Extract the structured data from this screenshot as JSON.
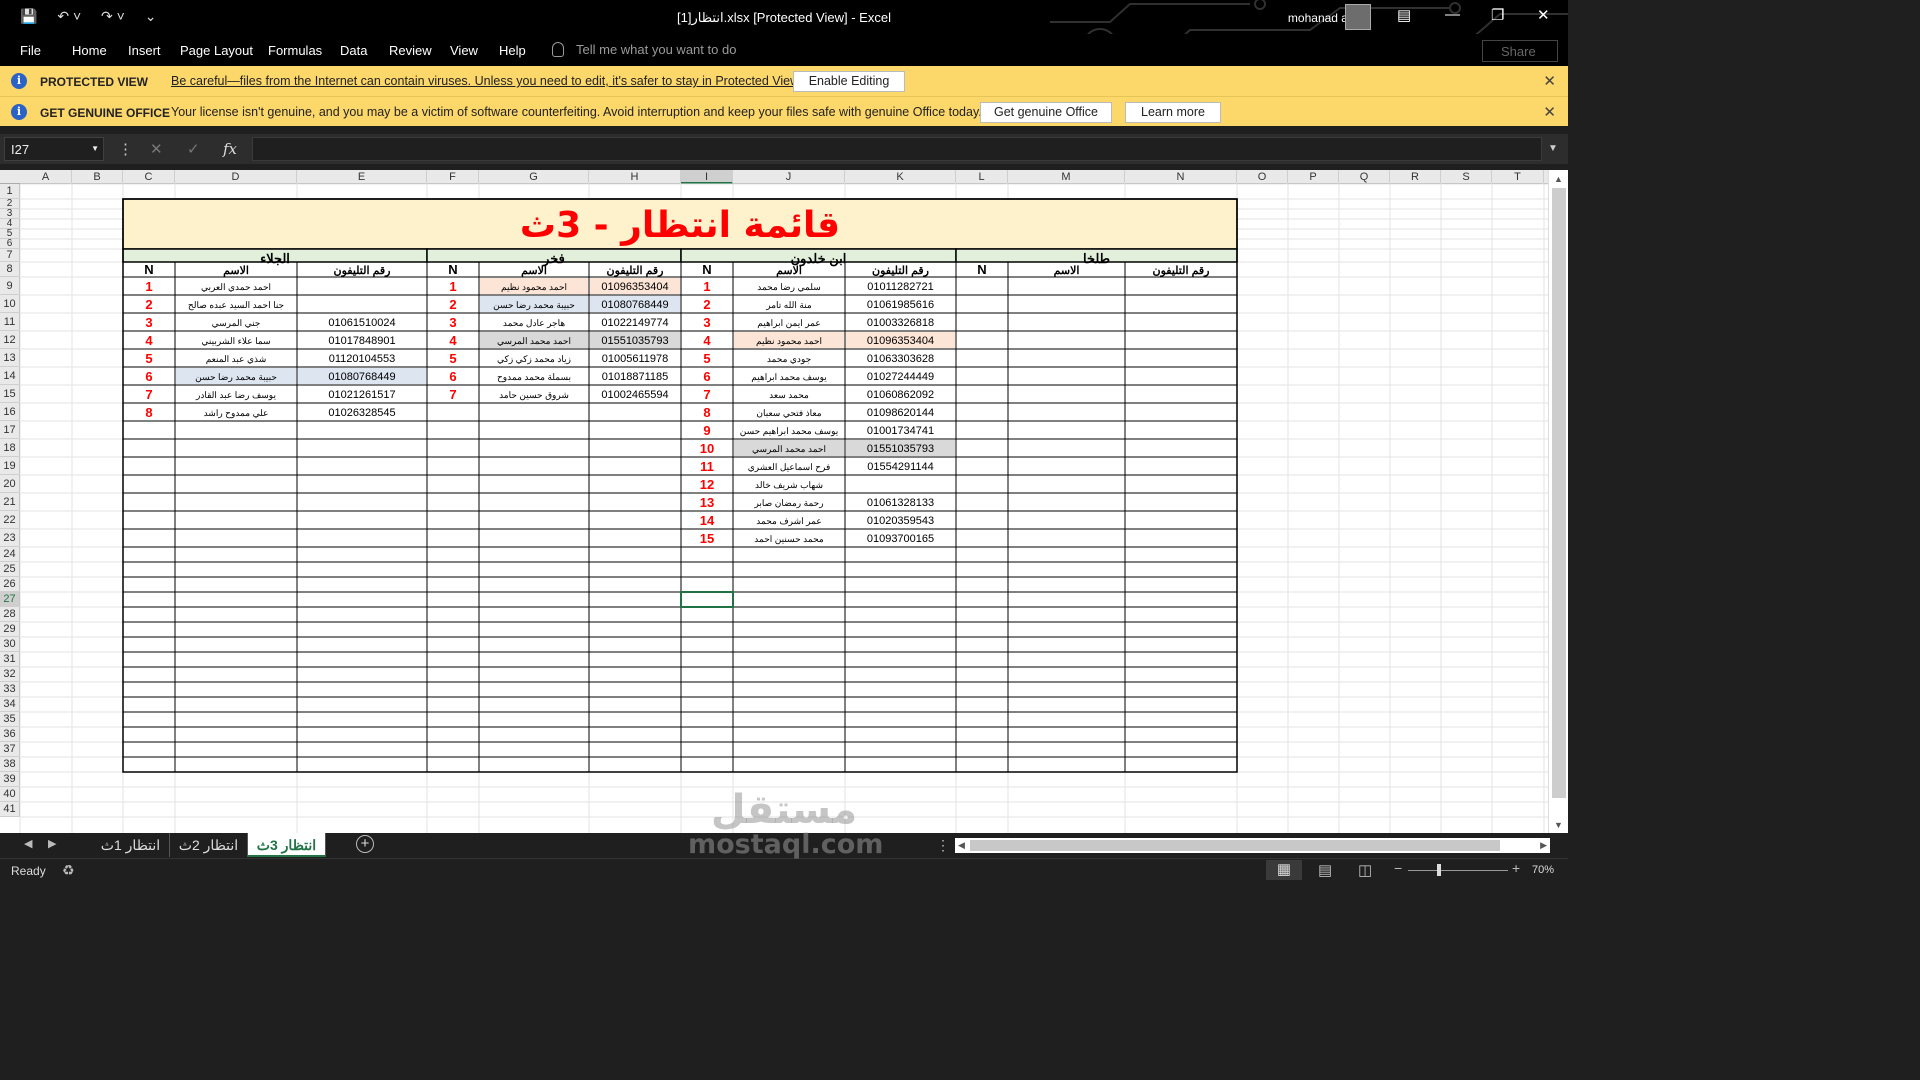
{
  "window": {
    "title": "انتظار[1].xlsx  [Protected View]  -  Excel",
    "user": "mohanad abdo",
    "share_label": "Share"
  },
  "menu": {
    "items": [
      "File",
      "Home",
      "Insert",
      "Page Layout",
      "Formulas",
      "Data",
      "Review",
      "View",
      "Help"
    ],
    "tell_placeholder": "Tell me what you want to do"
  },
  "protected_bar": {
    "title": "PROTECTED VIEW",
    "message": "Be careful—files from the Internet can contain viruses. Unless you need to edit, it's safer to stay in Protected View.",
    "button": "Enable Editing"
  },
  "genuine_bar": {
    "title": "GET GENUINE OFFICE",
    "message": "Your license isn't genuine, and you may be a victim of software counterfeiting. Avoid interruption and keep your files safe with genuine Office today.",
    "button1": "Get genuine Office",
    "button2": "Learn more"
  },
  "formula_bar": {
    "name_box": "I27",
    "fx_label": "fx",
    "value": ""
  },
  "columns": [
    "A",
    "B",
    "C",
    "D",
    "E",
    "F",
    "G",
    "H",
    "I",
    "J",
    "K",
    "L",
    "M",
    "N",
    "O",
    "P",
    "Q",
    "R",
    "S",
    "T"
  ],
  "selected": {
    "column": "I",
    "row": 27
  },
  "sheet": {
    "title": "قائمة انتظار - 3ث",
    "n_header": "N",
    "name_header": "الاسم",
    "phone_header": "رقم التليفون",
    "colors": {
      "title_bg": "#fef2cc",
      "title_fg": "#ff0000",
      "group_bg": "#e2efda",
      "num_fg": "#ff0000",
      "peach": "#fce4d6",
      "blue": "#dde5f0",
      "gray": "#d9d9d9"
    },
    "groups": [
      {
        "name": "الجلاء",
        "rows": [
          {
            "n": "1",
            "name": "احمد حمدي العربي",
            "phone": ""
          },
          {
            "n": "2",
            "name": "جنا احمد السيد عبده صالح",
            "phone": ""
          },
          {
            "n": "3",
            "name": "جني المرسي",
            "phone": "01061510024"
          },
          {
            "n": "4",
            "name": "سما علاء الشربيني",
            "phone": "01017848901"
          },
          {
            "n": "5",
            "name": "شذي عبد المنعم",
            "phone": "01120104553"
          },
          {
            "n": "6",
            "name": "حبيبة محمد رضا حسن",
            "phone": "01080768449",
            "hl": "blue"
          },
          {
            "n": "7",
            "name": "يوسف رضا عبد القادر",
            "phone": "01021261517"
          },
          {
            "n": "8",
            "name": "علي ممدوح راشد",
            "phone": "01026328545"
          }
        ]
      },
      {
        "name": "فخر",
        "rows": [
          {
            "n": "1",
            "name": "احمد محمود نظيم",
            "phone": "01096353404",
            "hl": "peach"
          },
          {
            "n": "2",
            "name": "حبيبة محمد رضا حسن",
            "phone": "01080768449",
            "hl": "blue"
          },
          {
            "n": "3",
            "name": "هاجر عادل محمد",
            "phone": "01022149774"
          },
          {
            "n": "4",
            "name": "احمد محمد المرسي",
            "phone": "01551035793",
            "hl": "gray"
          },
          {
            "n": "5",
            "name": "زياد محمد زكي زكي",
            "phone": "01005611978"
          },
          {
            "n": "6",
            "name": "بسملة محمد ممدوح",
            "phone": "01018871185"
          },
          {
            "n": "7",
            "name": "شروق حسين حامد",
            "phone": "01002465594"
          }
        ]
      },
      {
        "name": "ابن خلدون",
        "rows": [
          {
            "n": "1",
            "name": "سلمي رضا محمد",
            "phone": "01011282721"
          },
          {
            "n": "2",
            "name": "منة الله تامر",
            "phone": "01061985616"
          },
          {
            "n": "3",
            "name": "عمر ايمن ابراهيم",
            "phone": "01003326818"
          },
          {
            "n": "4",
            "name": "احمد محمود نظيم",
            "phone": "01096353404",
            "hl": "peach"
          },
          {
            "n": "5",
            "name": "جودي محمد",
            "phone": "01063303628"
          },
          {
            "n": "6",
            "name": "يوسف محمد ابراهيم",
            "phone": "01027244449"
          },
          {
            "n": "7",
            "name": "محمد سعد",
            "phone": "01060862092"
          },
          {
            "n": "8",
            "name": "معاذ فتحي سعبان",
            "phone": "01098620144"
          },
          {
            "n": "9",
            "name": "يوسف محمد ابراهيم حسن",
            "phone": "01001734741"
          },
          {
            "n": "10",
            "name": "احمد محمد المرسي",
            "phone": "01551035793",
            "hl": "gray"
          },
          {
            "n": "11",
            "name": "فرح اسماعيل العشري",
            "phone": "01554291144"
          },
          {
            "n": "12",
            "name": "شهاب شريف خالد",
            "phone": ""
          },
          {
            "n": "13",
            "name": "رحمة رمضان صابر",
            "phone": "01061328133"
          },
          {
            "n": "14",
            "name": "عمر اشرف محمد",
            "phone": "01020359543"
          },
          {
            "n": "15",
            "name": "محمد حسنين احمد",
            "phone": "01093700165"
          }
        ]
      },
      {
        "name": "طلخا",
        "rows": []
      }
    ]
  },
  "tabs": [
    {
      "label": "انتظار 1ث"
    },
    {
      "label": "انتظار 2ث"
    },
    {
      "label": "انتظار 3ث",
      "active": true
    }
  ],
  "status": {
    "ready": "Ready",
    "zoom": "70%"
  },
  "watermark": {
    "arabic": "مستقل",
    "latin": "mostaql.com"
  }
}
